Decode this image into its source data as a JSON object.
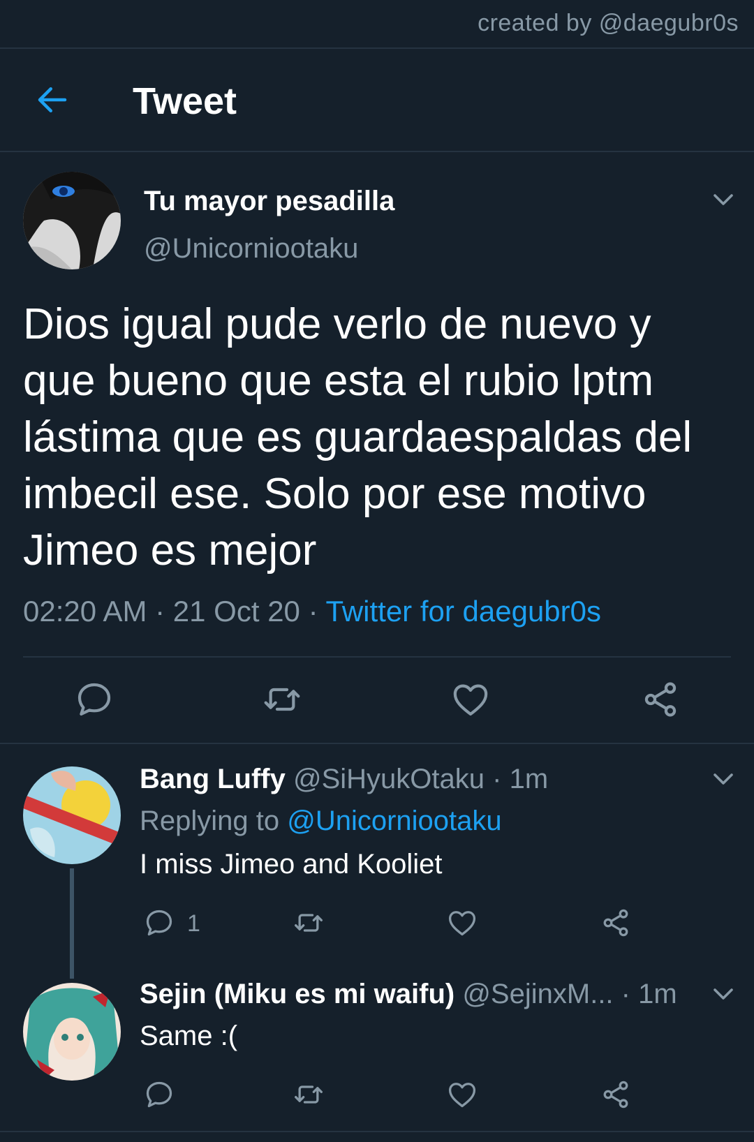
{
  "watermark": "created by @daegubr0s",
  "header": {
    "title": "Tweet",
    "back_icon": "arrow-left-icon"
  },
  "colors": {
    "background": "#15202b",
    "accent": "#1da1f2",
    "secondary_text": "#8899a6",
    "divider": "#253341"
  },
  "tweet": {
    "display_name": "Tu mayor pesadilla",
    "handle": "@Unicorniootaku",
    "text": "Dios igual pude verlo de nuevo y\nque bueno que esta el rubio lptm\nlástima que es guardaespaldas del\nimbecil ese. Solo por ese motivo\nJimeo es mejor",
    "time": "02:20 AM",
    "separator": " · ",
    "date": "21 Oct 20",
    "source": "Twitter for daegubr0s"
  },
  "replies": [
    {
      "display_name": "Bang Luffy",
      "handle": "@SiHyukOtaku",
      "time_sep": " · ",
      "time": "1m",
      "replying_prefix": "Replying to ",
      "replying_to": "@Unicorniootaku",
      "text": "I miss Jimeo and Kooliet",
      "reply_count": "1"
    },
    {
      "display_name": "Sejin (Miku es mi waifu)",
      "handle": "@SejinxM...",
      "time_sep": " · ",
      "time": "1m",
      "text": "Same :("
    }
  ]
}
